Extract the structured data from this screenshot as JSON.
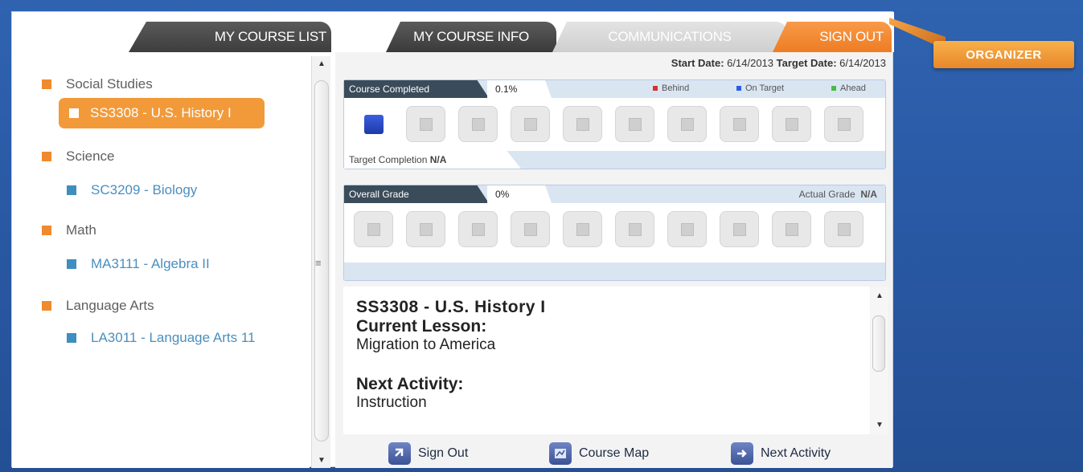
{
  "tabs": {
    "course_list": "MY COURSE LIST",
    "course_info": "MY COURSE INFO",
    "communications": "COMMUNICATIONS",
    "sign_out": "SIGN OUT"
  },
  "organizer_label": "ORGANIZER",
  "sidebar": {
    "subjects": [
      {
        "name": "Social Studies",
        "course": "SS3308 - U.S. History I",
        "selected": true
      },
      {
        "name": "Science",
        "course": "SC3209 - Biology",
        "selected": false
      },
      {
        "name": "Math",
        "course": "MA3111 - Algebra II",
        "selected": false
      },
      {
        "name": "Language Arts",
        "course": "LA3011 - Language Arts 11",
        "selected": false
      }
    ]
  },
  "dates": {
    "start_label": "Start Date:",
    "start_value": "6/14/2013",
    "target_label": "Target Date:",
    "target_value": "6/14/2013"
  },
  "progress": {
    "label": "Course Completed",
    "value": "0.1%",
    "legend": {
      "behind": "Behind",
      "on_target": "On Target",
      "ahead": "Ahead"
    },
    "target_completion_label": "Target Completion",
    "target_completion_value": "N/A"
  },
  "grade": {
    "label": "Overall Grade",
    "value": "0%",
    "actual_label": "Actual Grade",
    "actual_value": "N/A"
  },
  "lesson": {
    "course": "SS3308 - U.S. History I",
    "current_label": "Current Lesson:",
    "current_value": "Migration to America",
    "next_label": "Next Activity:",
    "next_value": "Instruction"
  },
  "actions": {
    "sign_out": "Sign Out",
    "course_map": "Course Map",
    "next_activity": "Next Activity"
  },
  "colors": {
    "accent_orange": "#ef8a2e",
    "course_blue": "#4a8fbe",
    "behind": "#d9302c",
    "on_target": "#2a5be8",
    "ahead": "#4cb84c",
    "background_blue": "#2f63b0"
  }
}
